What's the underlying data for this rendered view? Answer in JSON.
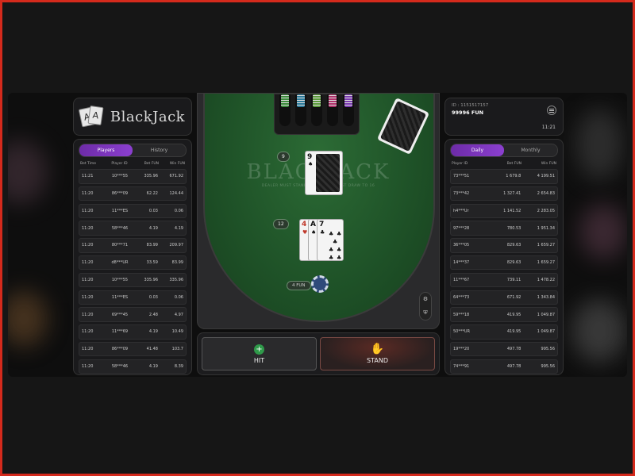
{
  "logo": {
    "text": "BlackJack",
    "card1": "A",
    "card2": "A"
  },
  "left": {
    "tabs": [
      "Players",
      "History"
    ],
    "headers": [
      "Bet Time",
      "Player ID",
      "Bet FUN",
      "Win FUN"
    ],
    "rows": [
      [
        "11:21",
        "10***55",
        "335.96",
        "671.92"
      ],
      [
        "11:20",
        "86***09",
        "62.22",
        "124.44"
      ],
      [
        "11:20",
        "11***ES",
        "0.03",
        "0.06"
      ],
      [
        "11:20",
        "58***46",
        "4.19",
        "4.19"
      ],
      [
        "11:20",
        "80***71",
        "83.99",
        "209.97"
      ],
      [
        "11:20",
        "d8***UR",
        "33.59",
        "83.99"
      ],
      [
        "11:20",
        "10***55",
        "335.96",
        "335.96"
      ],
      [
        "11:20",
        "11***ES",
        "0.03",
        "0.06"
      ],
      [
        "11:20",
        "69***45",
        "2.48",
        "4.97"
      ],
      [
        "11:20",
        "11***69",
        "4.19",
        "10.49"
      ],
      [
        "11:20",
        "86***09",
        "41.48",
        "103.7"
      ],
      [
        "11:20",
        "58***46",
        "4.19",
        "8.39"
      ]
    ]
  },
  "info": {
    "id": "ID : 1151517157",
    "balance": "99996 FUN",
    "time": "11:21"
  },
  "right": {
    "tabs": [
      "Daily",
      "Monthly"
    ],
    "headers": [
      "Player ID",
      "Bet FUN",
      "Win FUN"
    ],
    "rows": [
      [
        "73***51",
        "1 679.8",
        "4 199.51"
      ],
      [
        "73***42",
        "1 327.41",
        "2 654.83"
      ],
      [
        "h4***Ur",
        "1 141.52",
        "2 283.05"
      ],
      [
        "97***28",
        "780.53",
        "1 951.34"
      ],
      [
        "36***05",
        "829.63",
        "1 659.27"
      ],
      [
        "14***37",
        "829.63",
        "1 659.27"
      ],
      [
        "11***67",
        "739.11",
        "1 478.22"
      ],
      [
        "64***73",
        "671.92",
        "1 343.84"
      ],
      [
        "59***18",
        "419.95",
        "1 049.87"
      ],
      [
        "50***UR",
        "419.95",
        "1 049.87"
      ],
      [
        "19***20",
        "497.78",
        "995.56"
      ],
      [
        "74***91",
        "497.78",
        "995.56"
      ]
    ]
  },
  "table": {
    "felt_title": "BLACKJACK",
    "felt_rule": "DEALER MUST STAND TO 17, AND MUST DRAW TO 16",
    "dealer_score": "9",
    "dealer_card_rank": "9",
    "dealer_card_suit": "♠",
    "player_score": "12",
    "player_cards": [
      {
        "rank": "4",
        "suit": "♥"
      },
      {
        "rank": "A",
        "suit": "♠"
      },
      {
        "rank": "7",
        "suit": "♣"
      }
    ],
    "bet": "4 FUN",
    "chip_value": "4",
    "chip_colors": [
      "#3a8a3a",
      "#2a7a9a",
      "#5a9a3a",
      "#b0306a",
      "#7a3ab0"
    ]
  },
  "actions": {
    "hit": "HIT",
    "stand": "STAND"
  }
}
